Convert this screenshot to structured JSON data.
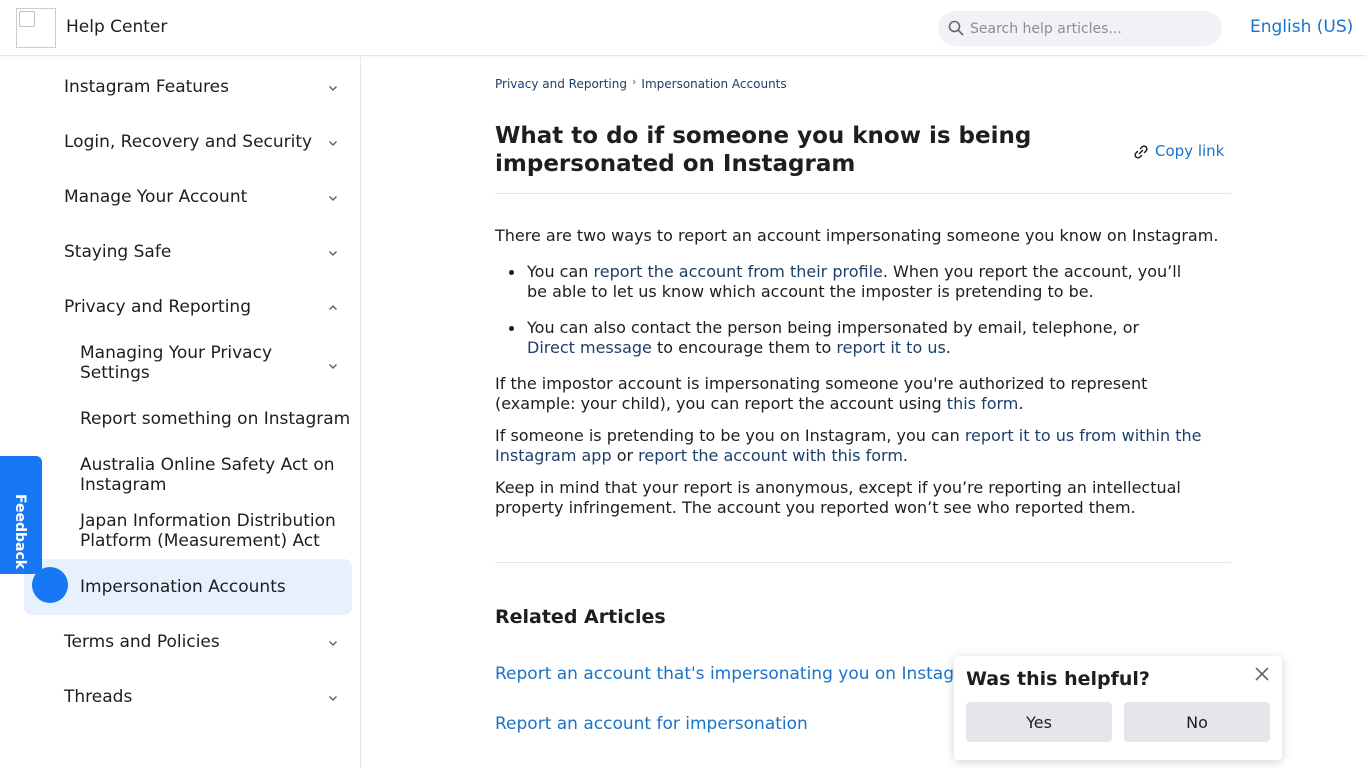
{
  "header": {
    "site_title": "Help Center",
    "search_placeholder": "Search help articles...",
    "language": "English (US)"
  },
  "sidebar": {
    "items": [
      {
        "label": "Instagram Features",
        "expanded": false
      },
      {
        "label": "Login, Recovery and Security",
        "expanded": false
      },
      {
        "label": "Manage Your Account",
        "expanded": false
      },
      {
        "label": "Staying Safe",
        "expanded": false
      },
      {
        "label": "Privacy and Reporting",
        "expanded": true
      },
      {
        "label": "Terms and Policies",
        "expanded": false
      },
      {
        "label": "Threads",
        "expanded": false
      }
    ],
    "subitems": [
      {
        "label": "Managing Your Privacy Settings",
        "has_children": true
      },
      {
        "label": "Report something on Instagram"
      },
      {
        "label": "Australia Online Safety Act on Instagram"
      },
      {
        "label": "Japan Information Distribution Platform (Measurement) Act"
      },
      {
        "label": "Impersonation Accounts",
        "active": true
      }
    ]
  },
  "feedback_tab": "Feedback",
  "breadcrumb": [
    "Privacy and Reporting",
    "Impersonation Accounts"
  ],
  "article": {
    "title": "What to do if someone you know is being impersonated on Instagram",
    "copy_link": "Copy link",
    "intro": "There are two ways to report an account impersonating someone you know on Instagram.",
    "bullet1": {
      "pre": "You can ",
      "link": "report the account from their profile",
      "post": ". When you report the account, you’ll be able to let us know which account the imposter is pretending to be."
    },
    "bullet2": {
      "pre": "You can also contact the person being impersonated by email, telephone, or ",
      "link1": "Direct message",
      "mid": " to encourage them to ",
      "link2": "report it to us",
      "post": "."
    },
    "para2": {
      "pre": "If the impostor account is impersonating someone you're authorized to represent (example: your child), you can report the account using ",
      "link": "this form",
      "post": "."
    },
    "para3": {
      "pre": "If someone is pretending to be you on Instagram, you can ",
      "link1": "report it to us from within the Instagram app",
      "mid": " or ",
      "link2": "report the account with this form",
      "post": "."
    },
    "para4": "Keep in mind that your report is anonymous, except if you’re reporting an intellectual property infringement. The account you reported won’t see who reported them."
  },
  "related": {
    "heading": "Related Articles",
    "links": [
      "Report an account that's impersonating you on Instagram",
      "Report an account for impersonation"
    ]
  },
  "helpful": {
    "title": "Was this helpful?",
    "yes": "Yes",
    "no": "No"
  },
  "colors": {
    "link": "#1a73c8",
    "inline_link": "#1c3f69",
    "accent": "#1877f2",
    "active_bg": "#e7f0fd"
  }
}
